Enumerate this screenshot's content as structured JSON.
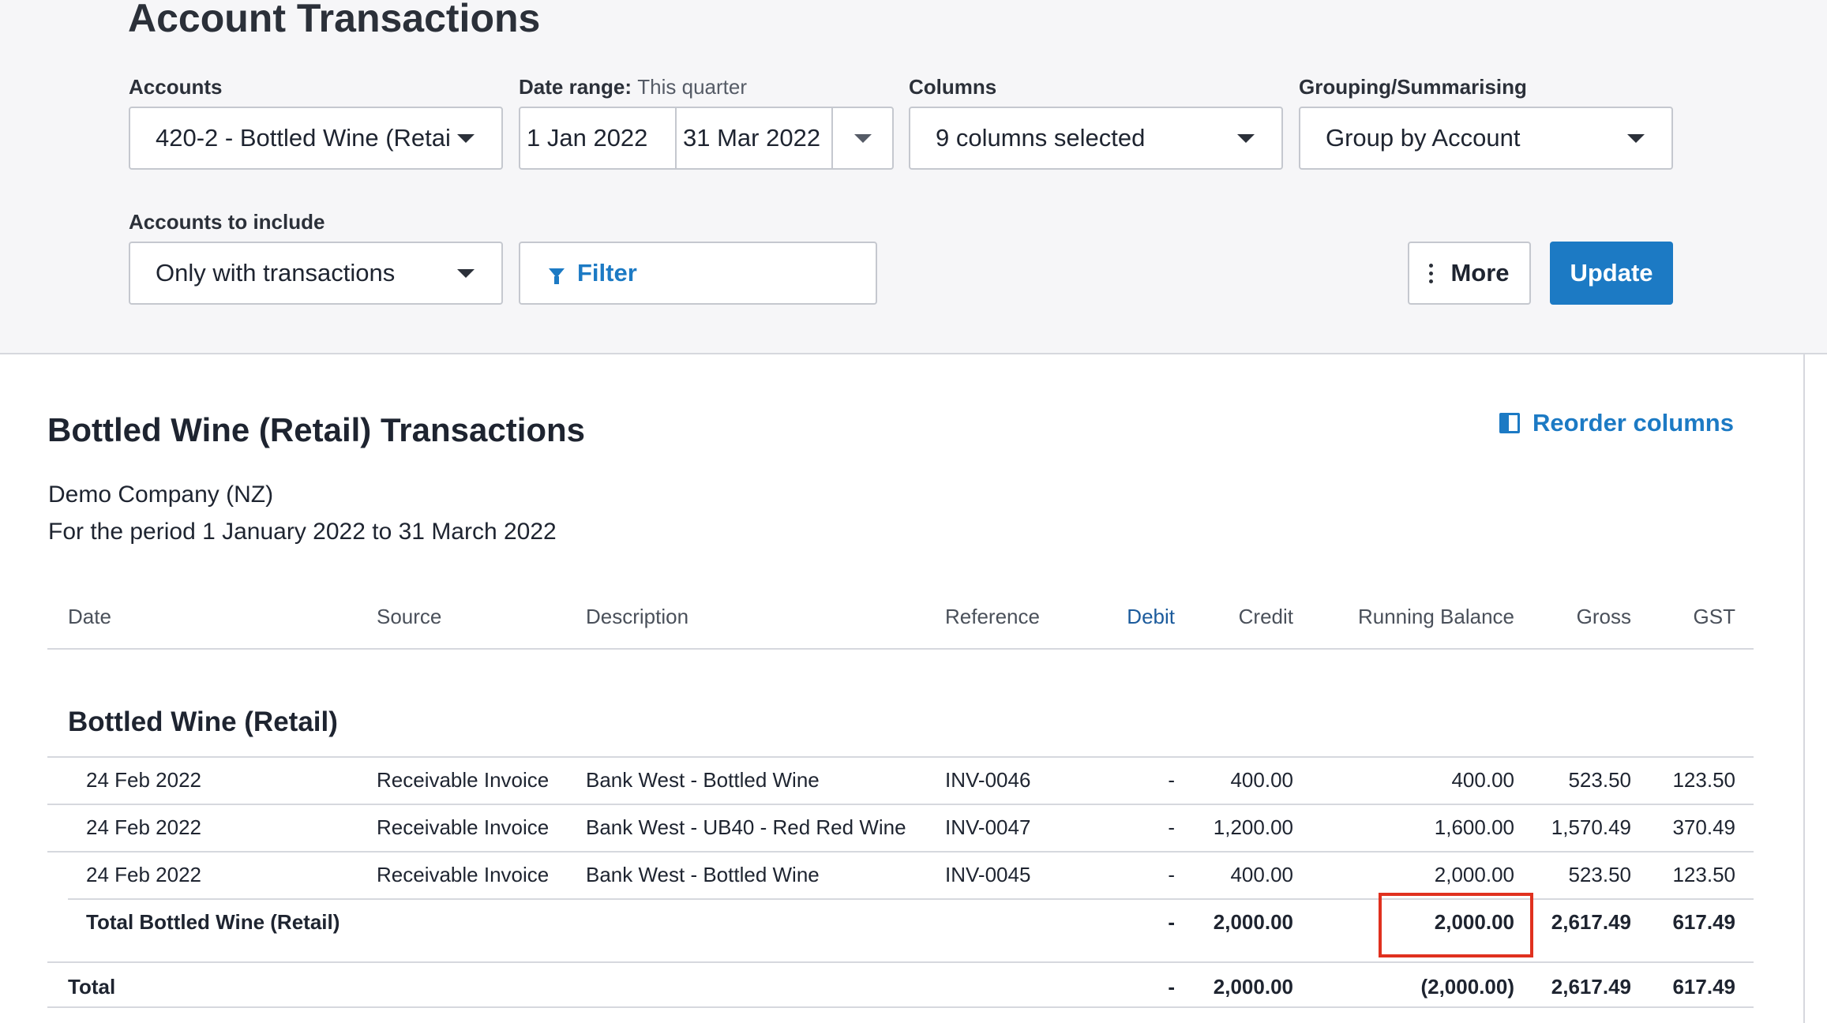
{
  "page_title": "Account Transactions",
  "filters": {
    "accounts_label": "Accounts",
    "accounts_value": "420-2 - Bottled Wine (Retai",
    "date_range_label": "Date range:",
    "date_range_value": "This quarter",
    "date_start": "1 Jan 2022",
    "date_end": "31 Mar 2022",
    "columns_label": "Columns",
    "columns_value": "9 columns selected",
    "grouping_label": "Grouping/Summarising",
    "grouping_value": "Group by Account",
    "include_label": "Accounts to include",
    "include_value": "Only with transactions",
    "filter_label": "Filter",
    "more_label": "More",
    "update_label": "Update"
  },
  "report": {
    "title": "Bottled Wine (Retail) Transactions",
    "reorder_label": "Reorder columns",
    "company": "Demo Company (NZ)",
    "period": "For the period 1 January 2022 to 31 March 2022",
    "columns": {
      "date": "Date",
      "source": "Source",
      "description": "Description",
      "reference": "Reference",
      "debit": "Debit",
      "credit": "Credit",
      "running_balance": "Running Balance",
      "gross": "Gross",
      "gst": "GST"
    },
    "section_title": "Bottled Wine (Retail)",
    "rows": [
      {
        "date": "24 Feb 2022",
        "source": "Receivable Invoice",
        "description": "Bank West - Bottled Wine",
        "reference": "INV-0046",
        "debit": "-",
        "credit": "400.00",
        "running_balance": "400.00",
        "gross": "523.50",
        "gst": "123.50"
      },
      {
        "date": "24 Feb 2022",
        "source": "Receivable Invoice",
        "description": "Bank West - UB40 - Red Red Wine",
        "reference": "INV-0047",
        "debit": "-",
        "credit": "1,200.00",
        "running_balance": "1,600.00",
        "gross": "1,570.49",
        "gst": "370.49"
      },
      {
        "date": "24 Feb 2022",
        "source": "Receivable Invoice",
        "description": "Bank West - Bottled Wine",
        "reference": "INV-0045",
        "debit": "-",
        "credit": "400.00",
        "running_balance": "2,000.00",
        "gross": "523.50",
        "gst": "123.50"
      }
    ],
    "subtotal": {
      "label": "Total Bottled Wine (Retail)",
      "debit": "-",
      "credit": "2,000.00",
      "running_balance": "2,000.00",
      "gross": "2,617.49",
      "gst": "617.49"
    },
    "total": {
      "label": "Total",
      "debit": "-",
      "credit": "2,000.00",
      "running_balance": "(2,000.00)",
      "gross": "2,617.49",
      "gst": "617.49"
    }
  },
  "colors": {
    "accent": "#1c7ac4",
    "highlight": "#e0311f"
  }
}
